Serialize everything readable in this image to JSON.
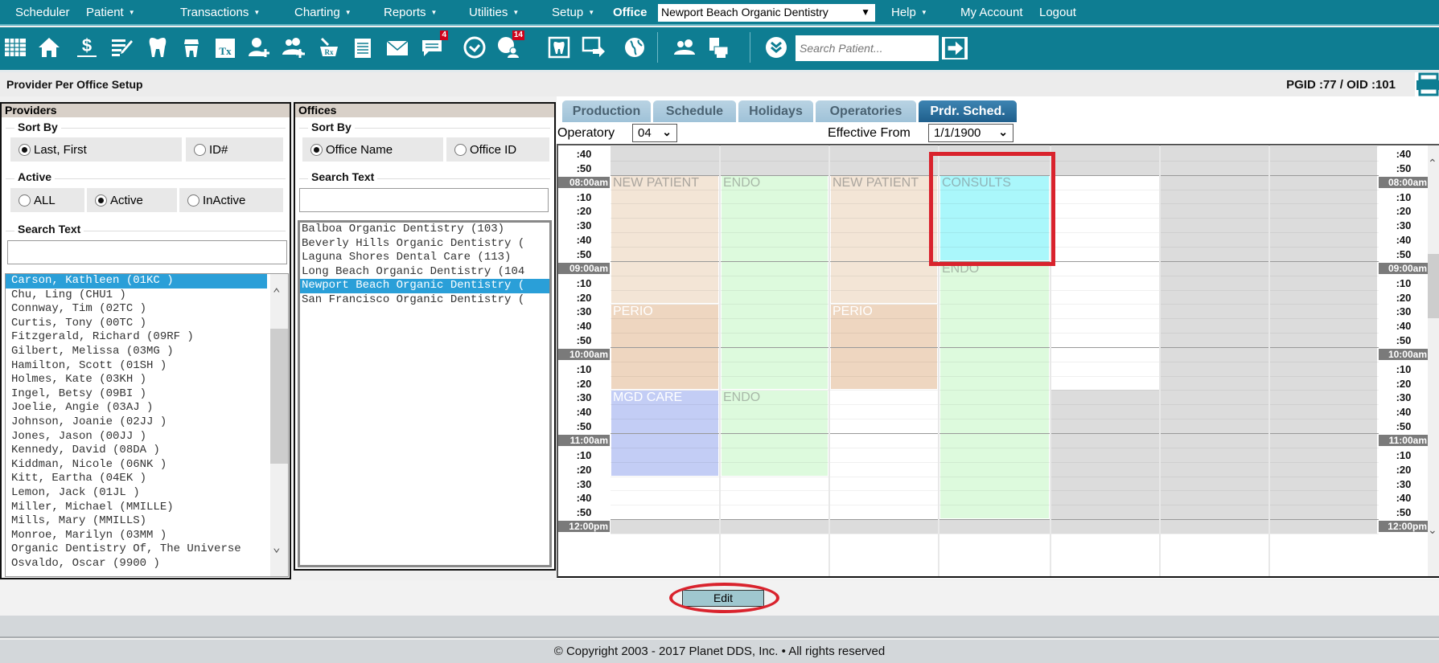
{
  "nav": {
    "items": [
      {
        "label": "Scheduler",
        "caret": false
      },
      {
        "label": "Patient",
        "caret": true
      },
      {
        "label": "Transactions",
        "caret": true
      },
      {
        "label": "Charting",
        "caret": true
      },
      {
        "label": "Reports",
        "caret": true
      },
      {
        "label": "Utilities",
        "caret": true
      },
      {
        "label": "Setup",
        "caret": true
      }
    ],
    "office_label": "Office",
    "office_selected": "Newport Beach Organic Dentistry",
    "help": "Help",
    "my_account": "My Account",
    "logout": "Logout",
    "caret_glyph": "▼"
  },
  "toolbar": {
    "icons": [
      "calendar-grid-icon",
      "home-icon",
      "billing-dollar-icon",
      "edit-notes-icon",
      "tooth-icon",
      "tooth-crown-icon",
      "treatment-tx-icon",
      "add-patient-icon",
      "add-family-icon",
      "prescription-icon",
      "notepad-icon",
      "mail-icon",
      "messages-icon",
      "clock-icon",
      "globe-user-icon",
      "xray-tooth-icon",
      "export-screen-icon",
      "globe-icon",
      "users-icon",
      "print-documents-icon",
      "expand-chevron-icon"
    ],
    "messages_badge": "4",
    "globe_user_badge": "14",
    "search_placeholder": "Search Patient...",
    "search_go_icon": "arrow-right-icon"
  },
  "title": {
    "page_title": "Provider Per Office Setup",
    "ids": "PGID :77  /  OID :101"
  },
  "providers": {
    "header": "Providers",
    "sort_by_label": "Sort By",
    "sort_options": [
      {
        "label": "Last, First",
        "checked": true
      },
      {
        "label": "ID#",
        "checked": false
      }
    ],
    "active_label": "Active",
    "active_options": [
      {
        "label": "ALL",
        "checked": false
      },
      {
        "label": "Active",
        "checked": true
      },
      {
        "label": "InActive",
        "checked": false
      }
    ],
    "search_label": "Search Text",
    "search_value": "",
    "list": [
      "Carson, Kathleen (01KC )",
      "Chu, Ling (CHU1 )",
      "Connway, Tim (02TC )",
      "Curtis, Tony (00TC )",
      "Fitzgerald, Richard (09RF )",
      "Gilbert, Melissa (03MG )",
      "Hamilton, Scott (01SH )",
      "Holmes, Kate (03KH )",
      "Ingel, Betsy (09BI )",
      "Joelie, Angie (03AJ )",
      "Johnson, Joanie (02JJ )",
      "Jones, Jason (00JJ )",
      "Kennedy, David (08DA )",
      "Kiddman, Nicole (06NK )",
      "Kitt, Eartha (04EK )",
      "Lemon, Jack (01JL )",
      "Miller, Michael (MMILLE)",
      "Mills, Mary (MMILLS)",
      "Monroe, Marilyn (03MM )",
      "Organic Dentistry Of, The Universe",
      "Osvaldo, Oscar (9900 )"
    ],
    "selected_index": 0
  },
  "offices": {
    "header": "Offices",
    "sort_by_label": "Sort By",
    "sort_options": [
      {
        "label": "Office Name",
        "checked": true
      },
      {
        "label": "Office ID",
        "checked": false
      }
    ],
    "search_label": "Search Text",
    "search_value": "",
    "list": [
      "Balboa Organic Dentistry (103)",
      "Beverly Hills Organic Dentistry (",
      "Laguna Shores Dental Care (113)",
      "Long Beach Organic Dentistry (104",
      "Newport Beach Organic Dentistry (",
      "San Francisco Organic Dentistry ("
    ],
    "selected_index": 4
  },
  "schedule": {
    "tabs": [
      {
        "label": "Production",
        "active": false
      },
      {
        "label": "Schedule",
        "active": false
      },
      {
        "label": "Holidays",
        "active": false
      },
      {
        "label": "Operatories",
        "active": false
      },
      {
        "label": "Prdr. Sched.",
        "active": true
      }
    ],
    "operatory_label": "Operatory",
    "operatory_value": "04",
    "effective_label": "Effective From",
    "effective_value": "1/1/1900",
    "chevron_glyph": "❯",
    "time_labels": [
      ":40",
      ":50",
      "08:00am",
      ":10",
      ":20",
      ":30",
      ":40",
      ":50",
      "09:00am",
      ":10",
      ":20",
      ":30",
      ":40",
      ":50",
      "10:00am",
      ":10",
      ":20",
      ":30",
      ":40",
      ":50",
      "11:00am",
      ":10",
      ":20",
      ":30",
      ":40",
      ":50",
      "12:00pm"
    ],
    "columns": 7,
    "blocks": [
      {
        "col": 0,
        "start": 2,
        "end": 11,
        "label": "NEW PATIENT",
        "color": "#f3e5d6",
        "text_color": "#aaa59e"
      },
      {
        "col": 0,
        "start": 11,
        "end": 17,
        "label": "PERIO",
        "color": "#eed6c0",
        "text_color": "#ffffff"
      },
      {
        "col": 0,
        "start": 17,
        "end": 23,
        "label": "MGD CARE",
        "color": "#c3cdf5",
        "text_color": "#ffffff"
      },
      {
        "col": 1,
        "start": 2,
        "end": 17,
        "label": "ENDO",
        "color": "#ddfadd",
        "text_color": "#a8b8a8"
      },
      {
        "col": 1,
        "start": 17,
        "end": 23,
        "label": "ENDO",
        "color": "#ddfadd",
        "text_color": "#a8b8a8"
      },
      {
        "col": 2,
        "start": 2,
        "end": 11,
        "label": "NEW PATIENT",
        "color": "#f3e5d6",
        "text_color": "#aaa59e"
      },
      {
        "col": 2,
        "start": 11,
        "end": 17,
        "label": "PERIO",
        "color": "#eed6c0",
        "text_color": "#ffffff"
      },
      {
        "col": 3,
        "start": 2,
        "end": 8,
        "label": "CONSULTS",
        "color": "#aaf7fb",
        "text_color": "#8fb4b8"
      },
      {
        "col": 3,
        "start": 8,
        "end": 26,
        "label": "ENDO",
        "color": "#ddfadd",
        "text_color": "#a8b8a8"
      }
    ],
    "unavailable": [
      {
        "col": 0,
        "start": 0,
        "end": 2
      },
      {
        "col": 1,
        "start": 0,
        "end": 2
      },
      {
        "col": 2,
        "start": 0,
        "end": 2
      },
      {
        "col": 3,
        "start": 0,
        "end": 2
      },
      {
        "col": 4,
        "start": 0,
        "end": 2
      },
      {
        "col": 4,
        "start": 17,
        "end": 27
      },
      {
        "col": 5,
        "start": 0,
        "end": 27
      },
      {
        "col": 6,
        "start": 0,
        "end": 27
      },
      {
        "col": 0,
        "start": 26,
        "end": 27
      },
      {
        "col": 1,
        "start": 26,
        "end": 27
      },
      {
        "col": 2,
        "start": 26,
        "end": 27
      },
      {
        "col": 3,
        "start": 26,
        "end": 27
      }
    ]
  },
  "actions": {
    "edit_label": "Edit"
  },
  "footer": {
    "copyright": "© Copyright 2003 - 2017 Planet DDS, Inc. • All rights reserved"
  }
}
